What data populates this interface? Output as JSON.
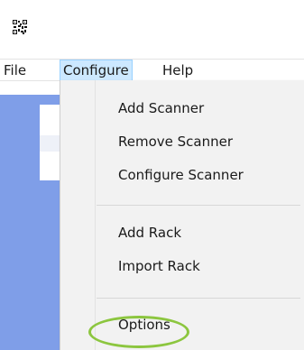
{
  "menubar": {
    "items": [
      {
        "label": "File"
      },
      {
        "label": "Configure"
      },
      {
        "label": "Help"
      }
    ]
  },
  "dropdown": {
    "items": [
      {
        "label": "Add Scanner"
      },
      {
        "label": "Remove Scanner"
      },
      {
        "label": "Configure Scanner"
      },
      {
        "label": "Add Rack"
      },
      {
        "label": "Import Rack"
      },
      {
        "label": "Options"
      }
    ]
  },
  "colors": {
    "menu_highlight": "#cce8ff",
    "menu_highlight_border": "#99d1ff",
    "panel_blue": "#7f9ee8",
    "annotation_green": "#8cc63f"
  },
  "icons": {
    "app": "qr-code-icon"
  }
}
